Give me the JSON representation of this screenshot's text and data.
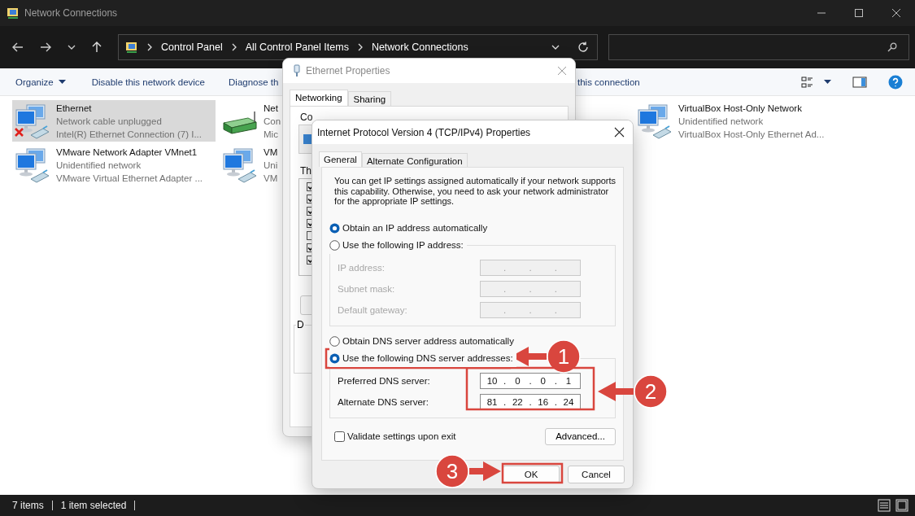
{
  "window": {
    "title": "Network Connections"
  },
  "address_bar": {
    "path": [
      "Control Panel",
      "All Control Panel Items",
      "Network Connections"
    ]
  },
  "command_bar": {
    "items": [
      {
        "label": "Organize",
        "kind": "menu"
      },
      {
        "label": "Disable this network device",
        "kind": "button"
      },
      {
        "label": "Diagnose th",
        "kind": "button"
      },
      {
        "label": "this connection",
        "kind": "button"
      }
    ]
  },
  "connections": [
    {
      "name": "Ethernet",
      "status": "Network cable unplugged",
      "device": "Intel(R) Ethernet Connection (7) I...",
      "kind": "computers",
      "selected": true,
      "disconnected": true
    },
    {
      "name": "Net",
      "status": "Con",
      "device": "Mic",
      "kind": "router",
      "selected": false,
      "disconnected": false
    },
    {
      "name": "VirtualBox Host-Only Network",
      "status": "Unidentified network",
      "device": "VirtualBox Host-Only Ethernet Ad...",
      "kind": "computers",
      "selected": false,
      "disconnected": false
    },
    {
      "name": "VMware Network Adapter VMnet1",
      "status": "Unidentified network",
      "device": "VMware Virtual Ethernet Adapter ...",
      "kind": "computers",
      "selected": false,
      "disconnected": false
    },
    {
      "name": "VM",
      "status": "Uni",
      "device": "VM",
      "kind": "computers",
      "selected": false,
      "disconnected": false
    }
  ],
  "status_bar": {
    "count": "7 items",
    "selection": "1 item selected"
  },
  "ethernet_dialog": {
    "title": "Ethernet Properties",
    "tabs": [
      {
        "label": "Networking",
        "selected": true
      },
      {
        "label": "Sharing",
        "selected": false
      }
    ],
    "connect_label": "Co",
    "items_label": "Th",
    "components": [
      {
        "checked": true
      },
      {
        "checked": true
      },
      {
        "checked": true
      },
      {
        "checked": true
      },
      {
        "checked": false
      },
      {
        "checked": true
      },
      {
        "checked": true
      }
    ],
    "group_label": "D"
  },
  "ipv4_dialog": {
    "title": "Internet Protocol Version 4 (TCP/IPv4) Properties",
    "tabs": [
      {
        "label": "General",
        "selected": true
      },
      {
        "label": "Alternate Configuration",
        "selected": false
      }
    ],
    "description": "You can get IP settings assigned automatically if your network supports this capability. Otherwise, you need to ask your network administrator for the appropriate IP settings.",
    "separator": ".",
    "ip_options": [
      {
        "label": "Obtain an IP address automatically",
        "selected": true
      },
      {
        "label": "Use the following IP address:",
        "selected": false
      }
    ],
    "ip_fields": [
      {
        "label": "IP address:",
        "disabled": true
      },
      {
        "label": "Subnet mask:",
        "disabled": true
      },
      {
        "label": "Default gateway:",
        "disabled": true
      }
    ],
    "dns_options": [
      {
        "label": "Obtain DNS server address automatically",
        "selected": false
      },
      {
        "label": "Use the following DNS server addresses:",
        "selected": true
      }
    ],
    "dns_fields": [
      {
        "label": "Preferred DNS server:",
        "octets": [
          "10",
          "0",
          "0",
          "1"
        ],
        "disabled": false
      },
      {
        "label": "Alternate DNS server:",
        "octets": [
          "81",
          "22",
          "16",
          "24"
        ],
        "disabled": false
      }
    ],
    "validate": {
      "label": "Validate settings upon exit",
      "checked": false
    },
    "advanced_button": "Advanced...",
    "buttons": [
      "OK",
      "Cancel"
    ]
  },
  "annotations": [
    {
      "number": "1"
    },
    {
      "number": "2"
    },
    {
      "number": "3"
    }
  ]
}
